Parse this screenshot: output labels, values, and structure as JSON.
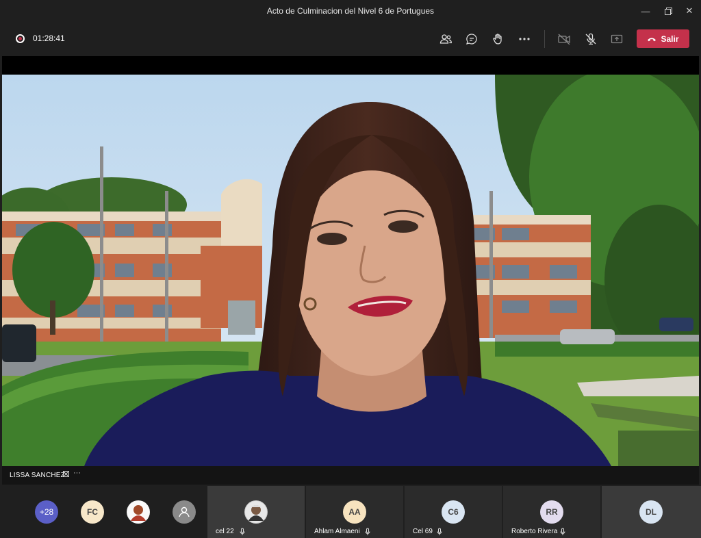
{
  "window": {
    "title": "Acto de Culminacion del Nivel 6 de Portugues"
  },
  "callbar": {
    "elapsed": "01:28:41",
    "leave_label": "Salir"
  },
  "stage": {
    "speaker_name": "LISSA SANCHEZ"
  },
  "participants": {
    "overflow_count": "+28",
    "gallery": [
      {
        "initials": "FC",
        "color": "#f7e7c9"
      },
      {
        "initials": "",
        "kind": "photo"
      },
      {
        "initials": "",
        "kind": "generic"
      }
    ],
    "tiles": [
      {
        "name": "cel 22",
        "initials": ""
      },
      {
        "name": "Ahlam Almaeni",
        "initials": "AA",
        "color": "#f7e3bf"
      },
      {
        "name": "Cel 69",
        "initials": "C6",
        "color": "#d9e5f2"
      },
      {
        "name": "Roberto Rivera",
        "initials": "RR",
        "color": "#e3dcef"
      },
      {
        "name": "",
        "initials": "DL",
        "color": "#d9e5f2"
      }
    ]
  },
  "colors": {
    "leave": "#c4314b",
    "overflow_badge": "#5b5fc7"
  }
}
